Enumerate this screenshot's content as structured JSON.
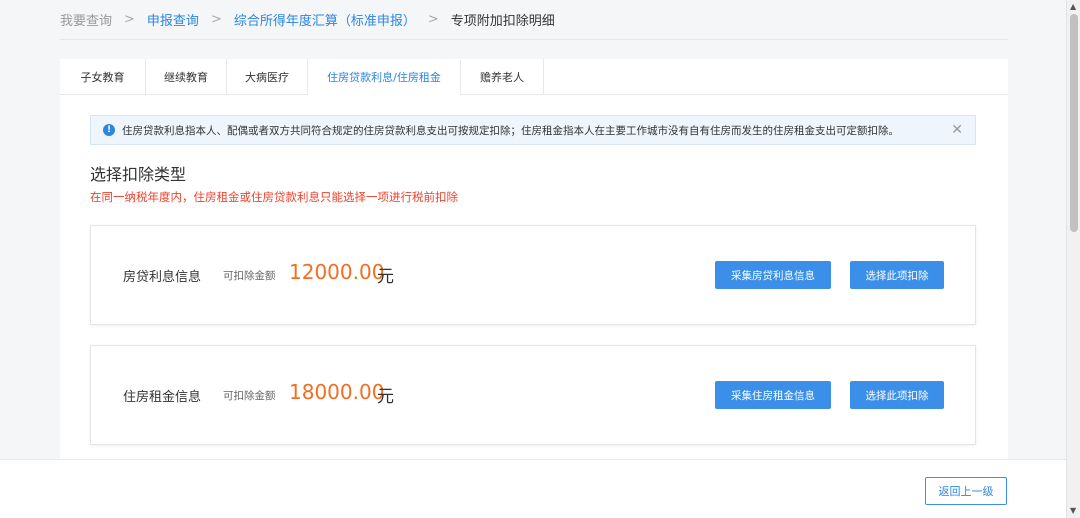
{
  "breadcrumb": {
    "items": [
      "我要查询",
      "申报查询",
      "综合所得年度汇算（标准申报）",
      "专项附加扣除明细"
    ],
    "separator": ">"
  },
  "tabs": [
    {
      "label": "子女教育",
      "active": false
    },
    {
      "label": "继续教育",
      "active": false
    },
    {
      "label": "大病医疗",
      "active": false
    },
    {
      "label": "住房贷款利息/住房租金",
      "active": true
    },
    {
      "label": "赡养老人",
      "active": false
    }
  ],
  "notice": {
    "icon": "info-icon",
    "icon_glyph": "!",
    "text": "住房贷款利息指本人、配偶或者双方共同符合规定的住房贷款利息支出可按规定扣除；住房租金指本人在主要工作城市没有自有住房而发生的住房租金支出可定额扣除。",
    "close_glyph": "✕"
  },
  "section": {
    "title": "选择扣除类型",
    "warning": "在同一纳税年度内，住房租金或住房贷款利息只能选择一项进行税前扣除"
  },
  "cards": [
    {
      "name": "房贷利息信息",
      "amount_label": "可扣除金额",
      "amount": "12000.00",
      "unit": "元",
      "collect_label": "采集房贷利息信息",
      "select_label": "选择此项扣除"
    },
    {
      "name": "住房租金信息",
      "amount_label": "可扣除金额",
      "amount": "18000.00",
      "unit": "元",
      "collect_label": "采集住房租金信息",
      "select_label": "选择此项扣除"
    }
  ],
  "footer": {
    "back_label": "返回上一级"
  },
  "scrollbar": {
    "up_glyph": "▲",
    "down_glyph": "▼"
  },
  "colors": {
    "accent": "#2b86e0",
    "button": "#3b8fe8",
    "amount": "#f56d1f",
    "warning": "#f0412c",
    "notice_bg": "#eef5fd"
  }
}
